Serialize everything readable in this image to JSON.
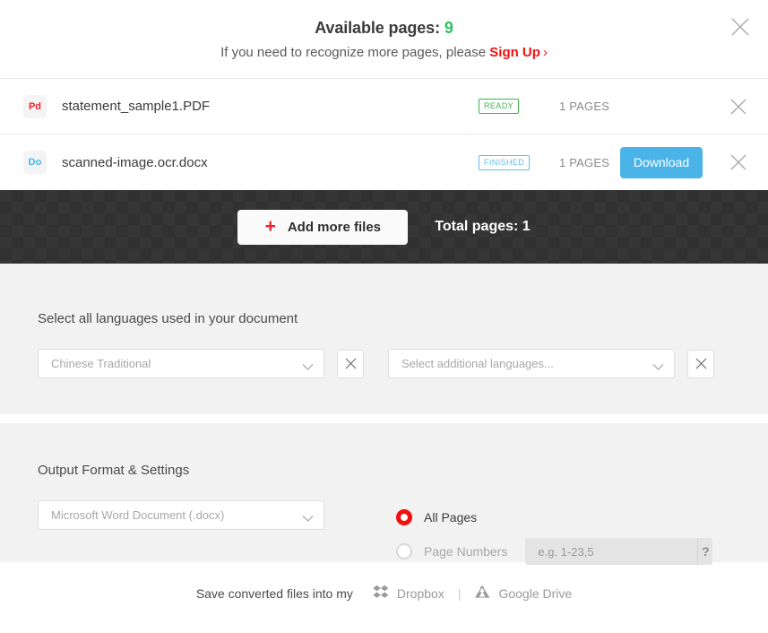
{
  "header": {
    "title_prefix": "Available pages:",
    "available_pages": "9",
    "subtitle_prefix": "If you need to recognize more pages, please",
    "signup_label": "Sign Up",
    "signup_chevron": "›",
    "close_icon": "close-icon"
  },
  "files": [
    {
      "type_label": "Pd",
      "type_class": "pdf",
      "name": "statement_sample1.PDF",
      "status": "READY",
      "status_class": "ready",
      "pages": "1 PAGES",
      "download_label": null
    },
    {
      "type_label": "Do",
      "type_class": "docx",
      "name": "scanned-image.ocr.docx",
      "status": "FINISHED",
      "status_class": "finished",
      "pages": "1 PAGES",
      "download_label": "Download"
    }
  ],
  "toolbar": {
    "add_files_label": "Add more files",
    "plus_icon": "+",
    "total_pages_label": "Total pages: 1"
  },
  "languages": {
    "section_label": "Select all languages used in your document",
    "primary_value": "Chinese Traditional",
    "additional_placeholder": "Select additional languages...",
    "clear_icon": "close-icon",
    "chevron_icon": "chevron-down-icon"
  },
  "output": {
    "section_label": "Output Format & Settings",
    "format_value": "Microsoft Word Document (.docx)",
    "all_pages_label": "All Pages",
    "page_numbers_label": "Page Numbers",
    "page_numbers_placeholder": "e.g. 1-23,5",
    "help_label": "?"
  },
  "footer": {
    "save_text": "Save converted files into my",
    "dropbox_label": "Dropbox",
    "divider": "|",
    "google_drive_label": "Google Drive"
  },
  "colors": {
    "green": "#3cb54a",
    "red": "#f01010",
    "blue": "#4ab4e8",
    "dark": "#363636"
  }
}
